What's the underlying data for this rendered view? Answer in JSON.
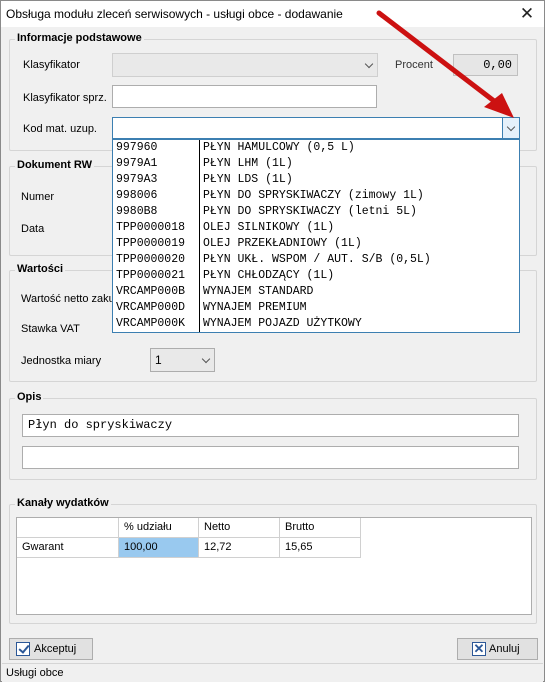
{
  "window": {
    "title": "Obsługa modułu zleceń serwisowych - usługi obce - dodawanie"
  },
  "basic": {
    "title": "Informacje podstawowe",
    "klasyfikator_label": "Klasyfikator",
    "klasyfikator_value": "",
    "procent_label": "Procent",
    "procent_value": "0,00",
    "klasyfikator_sprz_label": "Klasyfikator sprz.",
    "klasyfikator_sprz_value": "",
    "kod_label": "Kod mat. uzup.",
    "kod_value": ""
  },
  "dropdown": {
    "items": [
      {
        "code": "997960",
        "name": "PŁYN HAMULCOWY (0,5 L)"
      },
      {
        "code": "9979A1",
        "name": "PŁYN LHM (1L)"
      },
      {
        "code": "9979A3",
        "name": "PŁYN LDS (1L)"
      },
      {
        "code": "998006",
        "name": "PŁYN DO SPRYSKIWACZY (zimowy 1L)"
      },
      {
        "code": "9980B8",
        "name": "PŁYN DO SPRYSKIWACZY (letni 5L)"
      },
      {
        "code": "TPP0000018",
        "name": "OLEJ SILNIKOWY (1L)"
      },
      {
        "code": "TPP0000019",
        "name": "OLEJ PRZEKŁADNIOWY (1L)"
      },
      {
        "code": "TPP0000020",
        "name": "PŁYN UKŁ. WSPOM / AUT. S/B (0,5L)"
      },
      {
        "code": "TPP0000021",
        "name": "PŁYN CHŁODZĄCY (1L)"
      },
      {
        "code": "VRCAMP000B",
        "name": "WYNAJEM STANDARD"
      },
      {
        "code": "VRCAMP000D",
        "name": "WYNAJEM PREMIUM"
      },
      {
        "code": "VRCAMP000K",
        "name": "WYNAJEM POJAZD UŻYTKOWY"
      }
    ]
  },
  "dokument": {
    "title": "Dokument RW",
    "numer_label": "Numer",
    "data_label": "Data"
  },
  "wartosci": {
    "title": "Wartości",
    "netto_label": "Wartość netto zaku",
    "vat_label": "Stawka VAT",
    "jednostka_label": "Jednostka miary",
    "jednostka_value": "1"
  },
  "opis": {
    "title": "Opis",
    "line1": "Płyn do spryskiwaczy",
    "line2": ""
  },
  "kanaly": {
    "title": "Kanały wydatków",
    "columns": [
      "",
      "% udziału",
      "Netto",
      "Brutto"
    ],
    "rows": [
      {
        "name": "Gwarant",
        "udzial": "100,00",
        "netto": "12,72",
        "brutto": "15,65"
      }
    ]
  },
  "buttons": {
    "accept": "Akceptuj",
    "cancel": "Anuluj"
  },
  "status": {
    "text": "Usługi obce"
  },
  "colors": {
    "accent": "#3c7fb1",
    "selection": "#99c9ef",
    "annotation_arrow": "#cc1111"
  },
  "icons": {
    "accept": "check-icon",
    "cancel": "x-icon",
    "close": "close-icon",
    "dropdown": "chevron-down-icon"
  }
}
